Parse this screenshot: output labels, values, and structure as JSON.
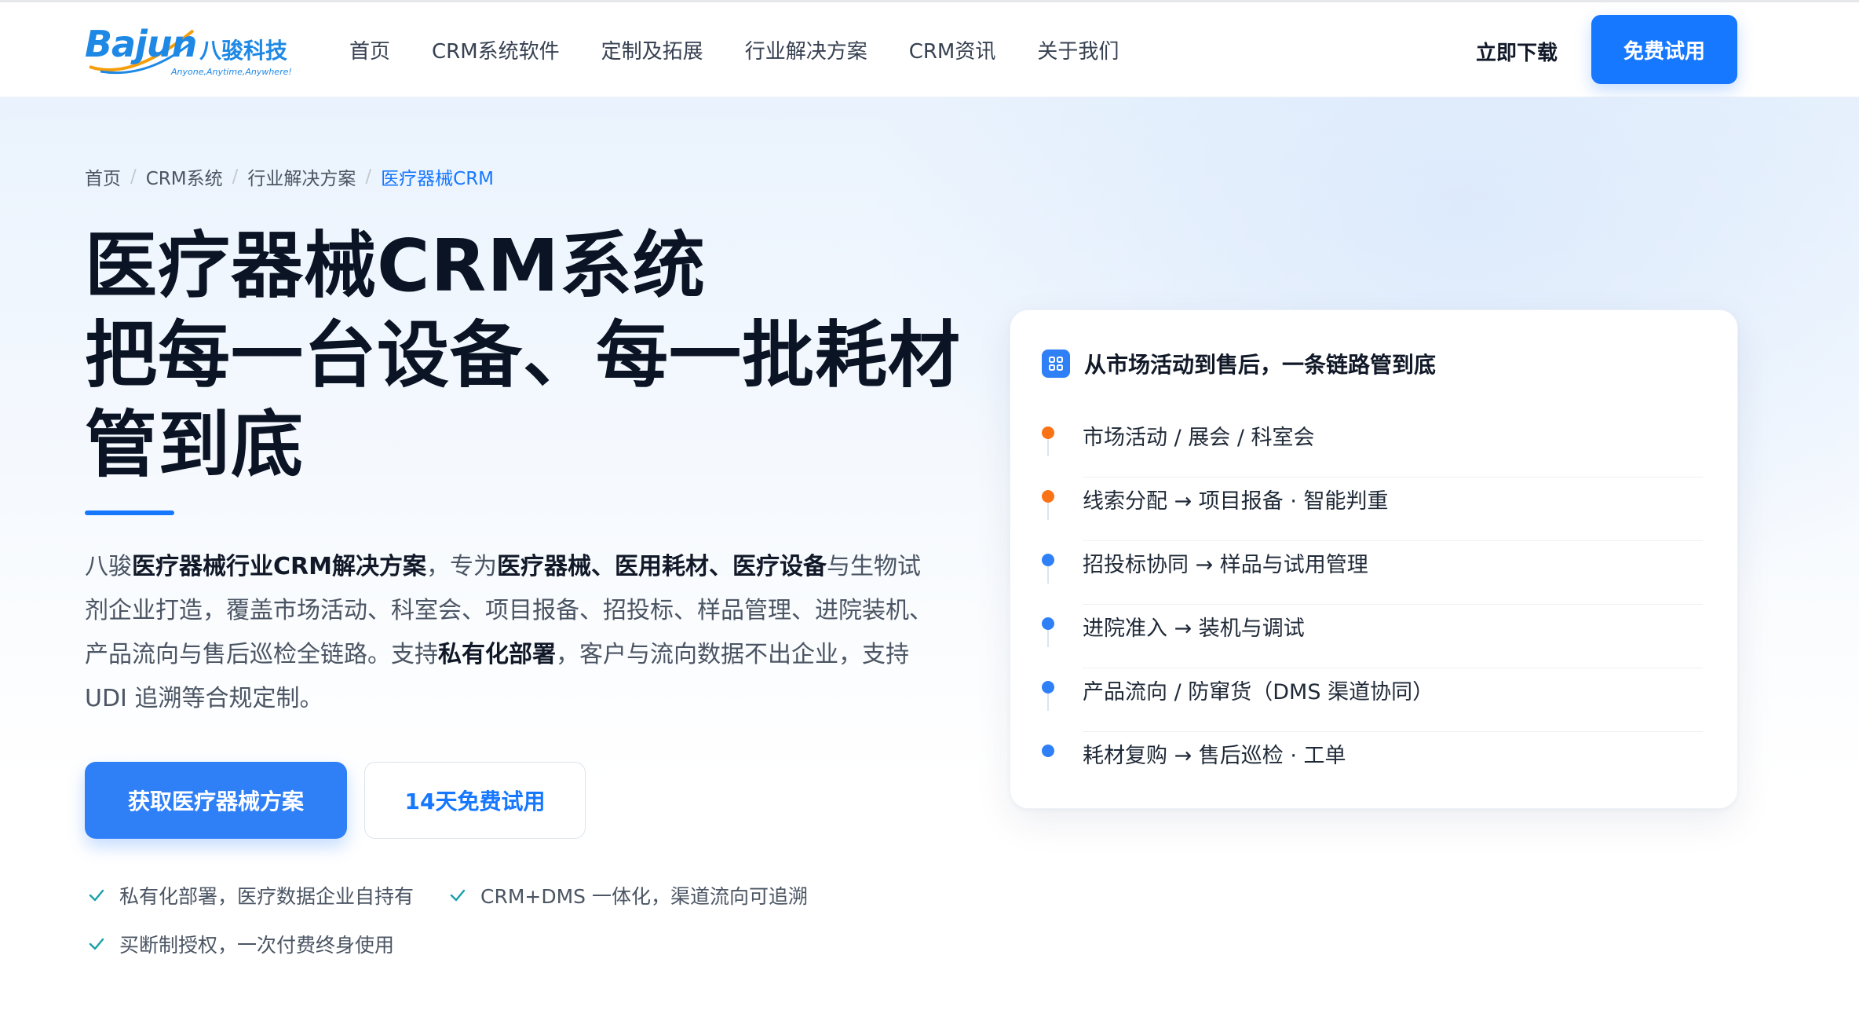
{
  "brand": {
    "logo_word": "Bajun",
    "logo_cn": "八骏科技",
    "slogan": "Anyone,Anytime,Anywhere!"
  },
  "nav": {
    "items": [
      "首页",
      "CRM系统软件",
      "定制及拓展",
      "行业解决方案",
      "CRM资讯",
      "关于我们"
    ],
    "download": "立即下载",
    "trial": "免费试用"
  },
  "breadcrumb": [
    "首页",
    "CRM系统",
    "行业解决方案",
    "医疗器械CRM"
  ],
  "hero": {
    "title_lines": [
      "医疗器械CRM系统",
      "把每一台设备、每一批耗材",
      "管到底"
    ],
    "desc": [
      {
        "t": "八骏",
        "b": false
      },
      {
        "t": "医疗器械行业CRM解决方案",
        "b": true
      },
      {
        "t": "，专为",
        "b": false
      },
      {
        "t": "医疗器械、医用耗材、医疗设备",
        "b": true
      },
      {
        "t": "与生物试剂企业打造，覆盖市场活动、科室会、项目报备、招投标、样品管理、进院装机、产品流向与售后巡检全链路。支持",
        "b": false
      },
      {
        "t": "私有化部署",
        "b": true
      },
      {
        "t": "，客户与流向数据不出企业，支持 UDI 追溯等合规定制。",
        "b": false
      }
    ],
    "primary_cta": "获取医疗器械方案",
    "secondary_cta": "14天免费试用",
    "features": [
      "私有化部署，医疗数据企业自持有",
      "CRM+DMS 一体化，渠道流向可追溯",
      "买断制授权，一次付费终身使用"
    ]
  },
  "card": {
    "title": "从市场活动到售后，一条链路管到底",
    "icon": "grid-icon",
    "steps": [
      {
        "label": "市场活动 / 展会 / 科室会",
        "color": "#f97316"
      },
      {
        "label": "线索分配 → 项目报备 · 智能判重",
        "color": "#f97316"
      },
      {
        "label": "招投标协同 → 样品与试用管理",
        "color": "#2f80f7"
      },
      {
        "label": "进院准入 → 装机与调试",
        "color": "#2f80f7"
      },
      {
        "label": "产品流向 / 防窜货（DMS 渠道协同）",
        "color": "#2f80f7"
      },
      {
        "label": "耗材复购 → 售后巡检 · 工单",
        "color": "#2f80f7"
      }
    ]
  },
  "colors": {
    "accent": "#1677ff",
    "check": "#19a0a8"
  }
}
